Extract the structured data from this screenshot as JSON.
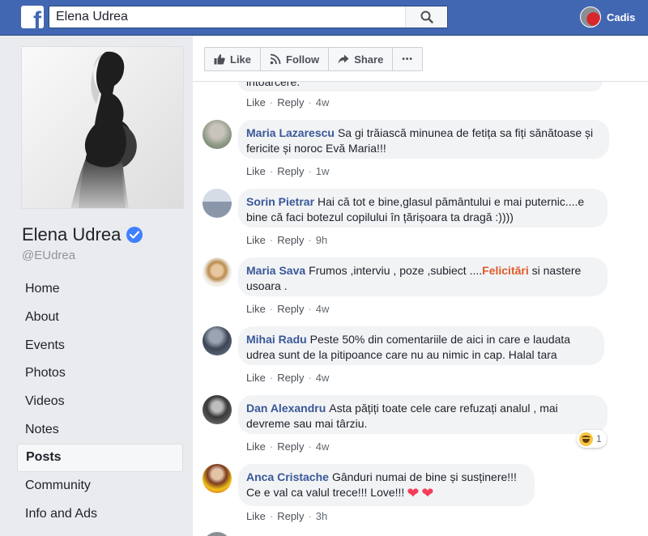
{
  "header": {
    "logo": "f",
    "search_value": "Elena Udrea",
    "user_name": "Cadis",
    "brand_color": "#4267b2"
  },
  "page": {
    "name": "Elena Udrea",
    "handle": "@EUdrea"
  },
  "nav": [
    {
      "label": "Home"
    },
    {
      "label": "About"
    },
    {
      "label": "Events"
    },
    {
      "label": "Photos"
    },
    {
      "label": "Videos"
    },
    {
      "label": "Notes"
    },
    {
      "label": "Posts",
      "active": true
    },
    {
      "label": "Community"
    },
    {
      "label": "Info and Ads"
    }
  ],
  "actions": {
    "like": "Like",
    "follow": "Follow",
    "share": "Share",
    "more": "•••"
  },
  "comment_actions": {
    "like": "Like",
    "reply": "Reply"
  },
  "comments": [
    {
      "author": "",
      "text": "intoarcere.",
      "time": "4w"
    },
    {
      "author": "Maria Lazarescu",
      "text": "Sa gi trăiască minunea de fetița sa fiți sănătoase și fericite și noroc Evă Maria!!!",
      "time": "1w"
    },
    {
      "author": "Sorin Pietrar",
      "text": "Hai că tot e bine,glasul pământului e mai puternic....e bine că faci botezul copilului în țărișoara ta dragă :))))",
      "time": "9h"
    },
    {
      "author": "Maria Sava",
      "text": "Frumos ,interviu , poze ,subiect ....",
      "highlight": "Felicitări",
      "text_after": " si nastere usoara .",
      "time": "4w"
    },
    {
      "author": "Mihai Radu",
      "text": "Peste 50% din comentariile de aici in care e laudata udrea sunt de la pitipoance care nu au nimic in cap. Halal tara",
      "time": "4w"
    },
    {
      "author": "Dan Alexandru",
      "text": "Asta pățiți toate cele care refuzați analul , mai devreme sau mai târziu.",
      "time": "4w",
      "reaction_count": "1"
    },
    {
      "author": "Anca Cristache",
      "text": "Gânduri numai de bine și susținere!!!",
      "text_line2": "Ce e val ca valul trece!!! Love!!!",
      "time": "3h"
    }
  ]
}
